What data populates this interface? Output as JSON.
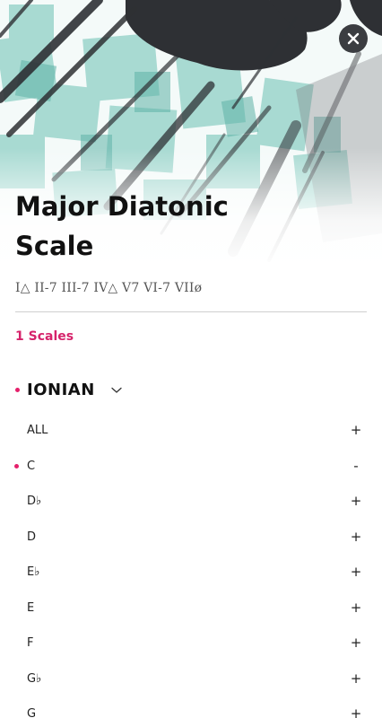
{
  "header": {
    "title": "Major Diatonic Scale",
    "close_icon": "close-icon"
  },
  "chords": "I△ II-7 III-7 IV△ V7 VI-7 VIIø",
  "scales_count": "1 Scales",
  "mode": {
    "name": "IONIAN",
    "expand_icon": "chevron-down-icon"
  },
  "keys": [
    {
      "label": "ALL",
      "action": "+",
      "selected": false
    },
    {
      "label": "C",
      "action": "-",
      "selected": true
    },
    {
      "label": "D♭",
      "action": "+",
      "selected": false
    },
    {
      "label": "D",
      "action": "+",
      "selected": false
    },
    {
      "label": "E♭",
      "action": "+",
      "selected": false
    },
    {
      "label": "E",
      "action": "+",
      "selected": false
    },
    {
      "label": "F",
      "action": "+",
      "selected": false
    },
    {
      "label": "G♭",
      "action": "+",
      "selected": false
    },
    {
      "label": "G",
      "action": "+",
      "selected": false
    }
  ],
  "colors": {
    "accent": "#d6236b",
    "hero_teal": "#7fc7bd",
    "hero_ink": "#2e3034"
  }
}
